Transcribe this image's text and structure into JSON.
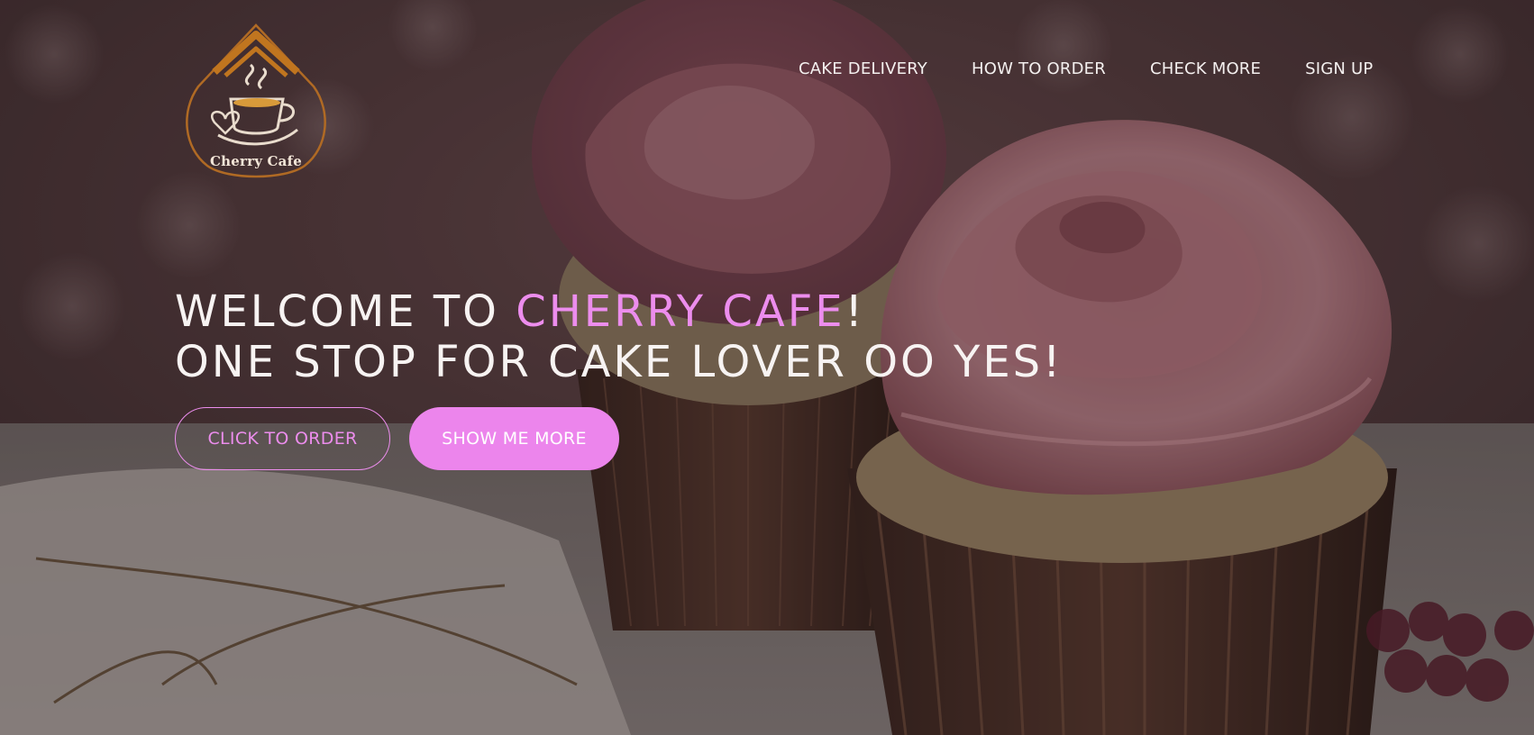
{
  "brand": {
    "logo_text": "Cherry Cafe",
    "accent_color": "#ec8ded",
    "logo_gold": "#c0751f"
  },
  "nav": {
    "items": [
      {
        "label": "CAKE DELIVERY"
      },
      {
        "label": "HOW TO ORDER"
      },
      {
        "label": "CHECK MORE"
      },
      {
        "label": "SIGN UP"
      }
    ]
  },
  "hero": {
    "line1_prefix": "WELCOME TO ",
    "line1_accent": "CHERRY CAFE",
    "line1_suffix": "!",
    "line2": "ONE STOP FOR CAKE LOVER OO YES!",
    "primary_button": "CLICK TO ORDER",
    "secondary_button": "SHOW ME MORE",
    "background_icon": "cupcake-photo"
  }
}
